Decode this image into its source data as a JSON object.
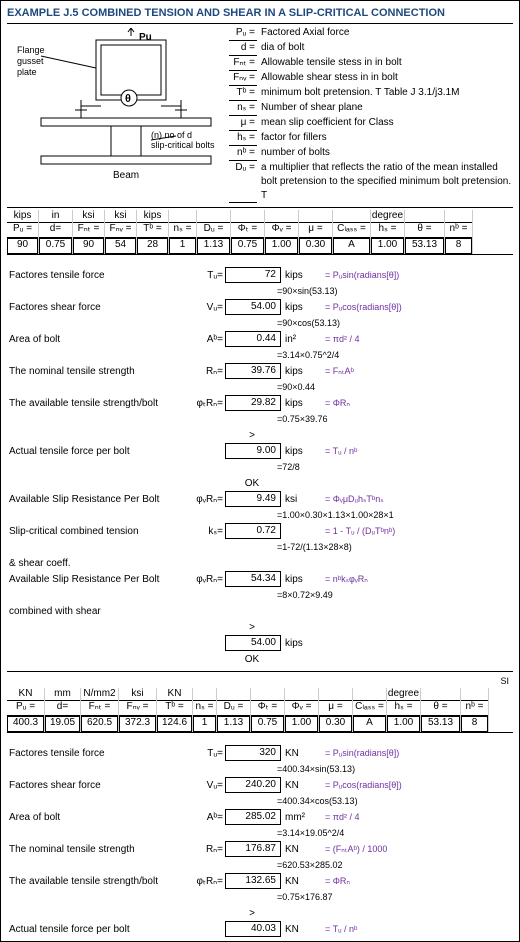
{
  "title": "EXAMPLE J.5 COMBINED TENSION AND SHEAR IN A SLIP-CRITICAL CONNECTION",
  "diagram": {
    "flange_label": "Flange gusset plate",
    "pu_label": "Pu",
    "theta_label": "θ",
    "bolts_label": "(n) no of d slip-critical bolts",
    "beam_label": "Beam"
  },
  "definitions": [
    {
      "sym": "Pᵤ =",
      "desc": "Factored Axial force"
    },
    {
      "sym": "d =",
      "desc": "dia of bolt"
    },
    {
      "sym": "Fₙₜ =",
      "desc": "Allowable tensile stess in in bolt"
    },
    {
      "sym": "Fₙᵥ =",
      "desc": "Allowable shear stess in in bolt"
    },
    {
      "sym": "Tᵇ =",
      "desc": "minimum bolt pretension. T Table J 3.1/j3.1M"
    },
    {
      "sym": "nₛ =",
      "desc": "Number of  shear plane"
    },
    {
      "sym": "μ =",
      "desc": "mean slip coefficient for Class"
    },
    {
      "sym": "hₛ =",
      "desc": "factor for fillers"
    },
    {
      "sym": "nᵇ =",
      "desc": "number of bolts"
    },
    {
      "sym": "Dᵤ =",
      "desc": "a multiplier that reflects the ratio of the mean installed bolt pretension to the specified minimum bolt pretension. T"
    }
  ],
  "inputs_us": {
    "units": [
      "kips",
      "in",
      "ksi",
      "ksi",
      "kips",
      "",
      "",
      "",
      "",
      "",
      "",
      "degree",
      ""
    ],
    "syms": [
      "Pᵤ =",
      "d=",
      "Fₙₜ =",
      "Fₙᵥ =",
      "Tᵇ =",
      "nₛ =",
      "Dᵤ =",
      "Φₜ =",
      "Φᵥ =",
      "μ =",
      "Cₗₐₛₛ =",
      "hₛ =",
      "θ =",
      "nᵇ ="
    ],
    "vals": [
      "90",
      "0.75",
      "90",
      "54",
      "28",
      "1",
      "1.13",
      "0.75",
      "1.00",
      "0.30",
      "A",
      "1.00",
      "53.13",
      "8"
    ]
  },
  "calcs_us": [
    {
      "label": "Factores tensile force",
      "sym": "Tᵤ=",
      "val": "72",
      "unit": "kips",
      "f1": "= Pᵤsin(radians[θ])",
      "f2": "=90×sin(53.13)"
    },
    {
      "label": "Factores shear force",
      "sym": "Vᵤ=",
      "val": "54.00",
      "unit": "kips",
      "f1": "= Pᵤcos(radians[θ])",
      "f2": "=90×cos(53.13)"
    },
    {
      "label": "Area of bolt",
      "sym": "Aᵇ=",
      "val": "0.44",
      "unit": "in²",
      "f1": "= πd² / 4",
      "f2": "=3.14×0.75^2/4"
    },
    {
      "label": "The nominal tensile strength",
      "sym": "Rₙ=",
      "val": "39.76",
      "unit": "kips",
      "f1": "= FₙₜAᵇ",
      "f2": "=90×0.44"
    },
    {
      "label": "The available tensile strength/bolt",
      "sym": "φₜRₙ=",
      "val": "29.82",
      "unit": "kips",
      "f1": "= ΦRₙ",
      "f2": "=0.75×39.76"
    },
    {
      "label": "Actual tensile force per bolt",
      "sym": "",
      "val": "9.00",
      "unit": "kips",
      "f1": "= Tᵤ / nᵇ",
      "f2": "=72/8",
      "check": "OK",
      "gt": ">"
    },
    {
      "label": "Available Slip Resistance Per Bolt",
      "sym": "φᵥRₙ=",
      "val": "9.49",
      "unit": "ksi",
      "f1": "= ΦᵥμDᵤhₛTᵇnₛ",
      "f2": "=1.00×0.30×1.13×1.00×28×1"
    },
    {
      "label": "Slip-critical combined tension",
      "sym": "kₛ=",
      "val": "0.72",
      "unit": "",
      "f1": "= 1 - Tᵤ / (DᵤTᵇnᵇ)",
      "f2": "=1-72/(1.13×28×8)"
    },
    {
      "label2": "& shear coeff."
    },
    {
      "label": "Available Slip Resistance Per Bolt",
      "sym": "φᵥRₙ=",
      "val": "54.34",
      "unit": "kips",
      "f1": "= nᵇkₛφᵥRₙ",
      "f2": "=8×0.72×9.49"
    },
    {
      "label2": "combined with shear"
    },
    {
      "label": "",
      "sym": "",
      "val": "54.00",
      "unit": "kips",
      "f1": "",
      "f2": "",
      "check": "OK",
      "gt": ">"
    }
  ],
  "inputs_si": {
    "units": [
      "KN",
      "mm",
      "N/mm2",
      "ksi",
      "KN",
      "",
      "",
      "",
      "",
      "",
      "",
      "degree",
      ""
    ],
    "syms": [
      "Pᵤ =",
      "d=",
      "Fₙₜ =",
      "Fₙᵥ =",
      "Tᵇ =",
      "nₛ =",
      "Dᵤ =",
      "Φₜ =",
      "Φᵥ =",
      "μ =",
      "Cₗₐₛₛ =",
      "hₛ =",
      "θ =",
      "nᵇ ="
    ],
    "vals": [
      "400.3",
      "19.05",
      "620.5",
      "372.3",
      "124.6",
      "1",
      "1.13",
      "0.75",
      "1.00",
      "0.30",
      "A",
      "1.00",
      "53.13",
      "8"
    ]
  },
  "calcs_si": [
    {
      "label": "Factores tensile force",
      "sym": "Tᵤ=",
      "val": "320",
      "unit": "KN",
      "f1": "= Pᵤsin(radians[θ])",
      "f2": "=400.34×sin(53.13)"
    },
    {
      "label": "Factores shear force",
      "sym": "Vᵤ=",
      "val": "240.20",
      "unit": "KN",
      "f1": "= Pᵤcos(radians[θ])",
      "f2": "=400.34×cos(53.13)"
    },
    {
      "label": "Area of bolt",
      "sym": "Aᵇ=",
      "val": "285.02",
      "unit": "mm²",
      "f1": "= πd² / 4",
      "f2": "=3.14×19.05^2/4"
    },
    {
      "label": "The nominal tensile strength",
      "sym": "Rₙ=",
      "val": "176.87",
      "unit": "KN",
      "f1": "= (FₙₜAᵇ) / 1000",
      "f2": "=620.53×285.02"
    },
    {
      "label": "The available tensile strength/bolt",
      "sym": "φₜRₙ=",
      "val": "132.65",
      "unit": "KN",
      "f1": "= ΦRₙ",
      "f2": "=0.75×176.87"
    },
    {
      "label": "Actual tensile force per bolt",
      "sym": "",
      "val": "40.03",
      "unit": "KN",
      "f1": "= Tᵤ / nᵇ",
      "f2": "",
      "gt": ">"
    }
  ],
  "si_label": "SI"
}
